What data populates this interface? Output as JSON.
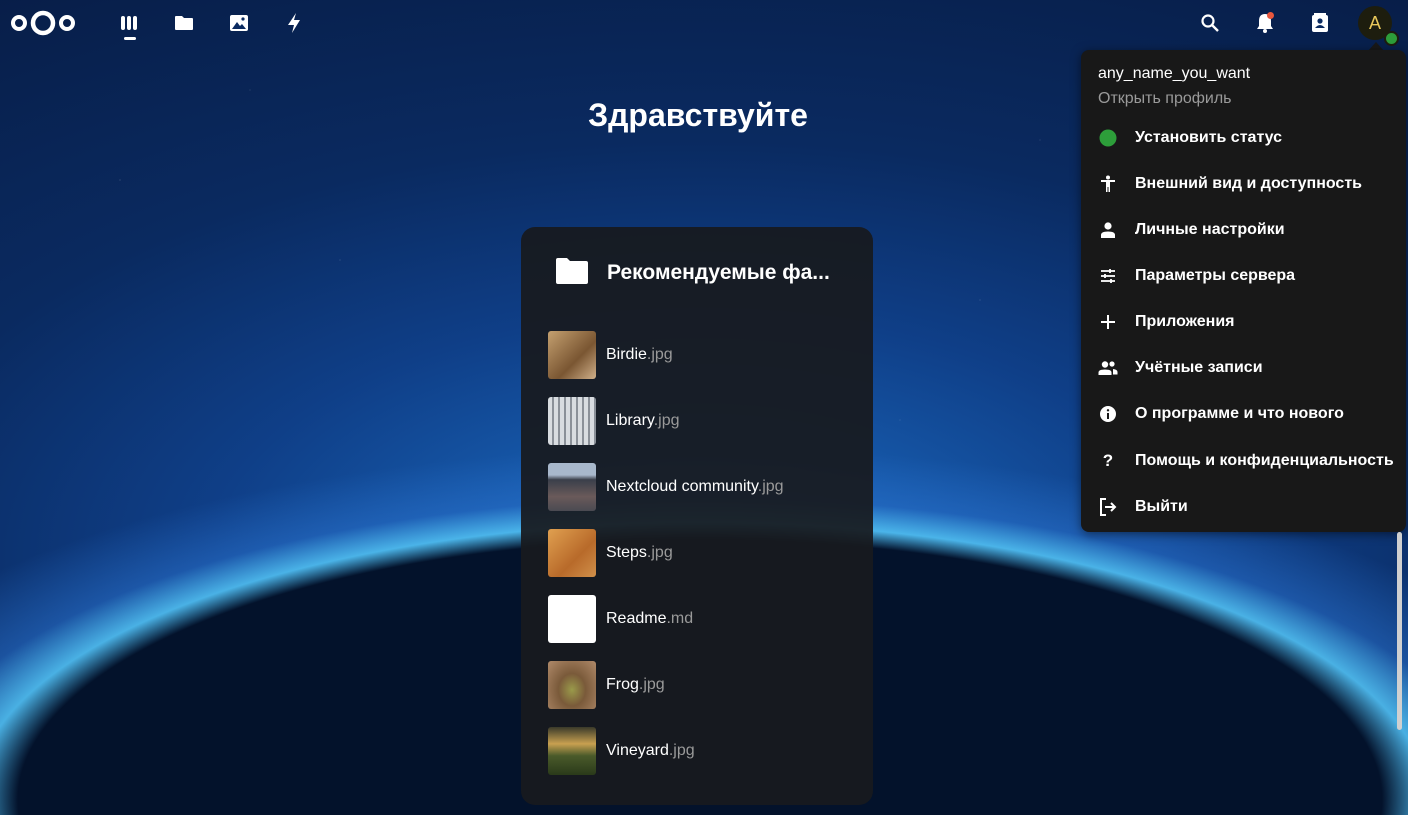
{
  "header": {
    "nav": [
      {
        "name": "dashboard-icon"
      },
      {
        "name": "files-icon"
      },
      {
        "name": "photos-icon"
      },
      {
        "name": "activity-icon"
      }
    ],
    "right_icons": [
      "search-icon",
      "notifications-icon",
      "contacts-icon"
    ],
    "avatar_letter": "A"
  },
  "greeting": "Здравствуйте",
  "recommended": {
    "title": "Рекомендуемые фа...",
    "files": [
      {
        "name": "Birdie",
        "ext": ".jpg",
        "thumb": "#a07a52"
      },
      {
        "name": "Library",
        "ext": ".jpg",
        "thumb": "#b8bcc2"
      },
      {
        "name": "Nextcloud community",
        "ext": ".jpg",
        "thumb": "#5a6478"
      },
      {
        "name": "Steps",
        "ext": ".jpg",
        "thumb": "#c8803a"
      },
      {
        "name": "Readme",
        "ext": ".md",
        "thumb": "#ffffff"
      },
      {
        "name": "Frog",
        "ext": ".jpg",
        "thumb": "#8a6a48"
      },
      {
        "name": "Vineyard",
        "ext": ".jpg",
        "thumb": "#6e6a3a"
      }
    ]
  },
  "user_menu": {
    "username": "any_name_you_want",
    "profile_link": "Открыть профиль",
    "items": [
      {
        "label": "Установить статус",
        "icon": "status-dot-icon"
      },
      {
        "label": "Внешний вид и доступность",
        "icon": "accessibility-icon"
      },
      {
        "label": "Личные настройки",
        "icon": "person-icon"
      },
      {
        "label": "Параметры сервера",
        "icon": "sliders-icon"
      },
      {
        "label": "Приложения",
        "icon": "plus-icon"
      },
      {
        "label": "Учётные записи",
        "icon": "users-icon"
      },
      {
        "label": "О программе и что нового",
        "icon": "info-icon"
      },
      {
        "label": "Помощь и конфиденциальность",
        "icon": "help-icon"
      },
      {
        "label": "Выйти",
        "icon": "logout-icon"
      }
    ]
  },
  "colors": {
    "accent": "#2d9e3a",
    "menu_bg": "#181818",
    "card_bg": "#181a1e"
  }
}
